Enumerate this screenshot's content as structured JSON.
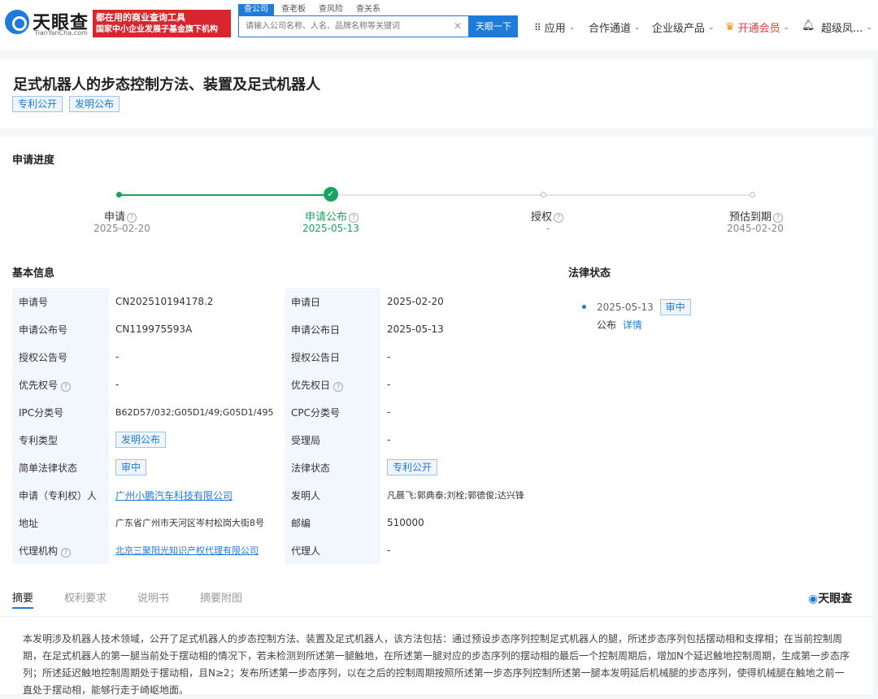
{
  "header": {
    "logo_text": "天眼查",
    "logo_sub": "TianYanCha.com",
    "banner_line1": "都在用的商业查询工具",
    "banner_line2": "国家中小企业发展子基金旗下机构",
    "search_tabs": [
      "查公司",
      "查老板",
      "查风险",
      "查关系"
    ],
    "search_placeholder": "请输入公司名称、人名、品牌名称等关键词",
    "search_button": "天眼一下",
    "nav_apps": "应用",
    "nav_cooperation": "合作通道",
    "nav_products": "企业级产品",
    "nav_vip": "开通会员",
    "nav_user": "超级凤..."
  },
  "title": {
    "text": "足式机器人的步态控制方法、装置及足式机器人",
    "tags": [
      "专利公开",
      "发明公布"
    ]
  },
  "progress": {
    "title": "申请进度",
    "steps": [
      {
        "label": "申请",
        "date": "2025-02-20"
      },
      {
        "label": "申请公布",
        "date": "2025-05-13"
      },
      {
        "label": "授权",
        "date": "-"
      },
      {
        "label": "预估到期",
        "date": "2045-02-20"
      }
    ],
    "completed_steps": 2
  },
  "basic": {
    "title": "基本信息",
    "rows": [
      {
        "k1": "申请号",
        "v1": "CN202510194178.2",
        "k2": "申请日",
        "v2": "2025-02-20"
      },
      {
        "k1": "申请公布号",
        "v1": "CN119975593A",
        "k2": "申请公布日",
        "v2": "2025-05-13"
      },
      {
        "k1": "授权公告号",
        "v1": "-",
        "k2": "授权公告日",
        "v2": "-"
      },
      {
        "k1": "优先权号",
        "v1": "-",
        "k2": "优先权日",
        "v2": "-"
      },
      {
        "k1": "IPC分类号",
        "v1": "B62D57/032;G05D1/49;G05D1/495",
        "k2": "CPC分类号",
        "v2": "-"
      },
      {
        "k1": "专利类型",
        "v1": "发明公布",
        "k2": "受理局",
        "v2": "-"
      },
      {
        "k1": "简单法律状态",
        "v1": "审中",
        "k2": "法律状态",
        "v2": "专利公开"
      },
      {
        "k1": "申请（专利权）人",
        "v1": "广州小鹏汽车科技有限公司",
        "k2": "发明人",
        "v2": "凡晨飞;郭典泰;刘栓;郭德俊;达兴锋"
      },
      {
        "k1": "地址",
        "v1": "广东省广州市天河区岑村松岗大街8号",
        "k2": "邮编",
        "v2": "510000"
      },
      {
        "k1": "代理机构",
        "v1": "北京三聚阳光知识产权代理有限公司",
        "k2": "代理人",
        "v2": "-"
      }
    ]
  },
  "law": {
    "title": "法律状态",
    "date": "2025-05-13",
    "badge": "审中",
    "event": "公布",
    "detail_link": "详情"
  },
  "tabs": [
    "摘要",
    "权利要求",
    "说明书",
    "摘要附图"
  ],
  "brand_mark": "天眼查",
  "abstract": "本发明涉及机器人技术领域，公开了足式机器人的步态控制方法、装置及足式机器人，该方法包括：通过预设步态序列控制足式机器人的腿，所述步态序列包括摆动相和支撑相；在当前控制周期，在足式机器人的第一腿当前处于摆动相的情况下，若未检测到所述第一腿触地，在所述第一腿对应的步态序列的摆动相的最后一个控制周期后，增加N个延迟触地控制周期，生成第一步态序列；所述延迟触地控制周期处于摆动相，且N≥2；发布所述第一步态序列，以在之后的控制周期按照所述第一步态序列控制所述第一腿本发明延后机械腿的步态序列，使得机械腿在触地之前一直处于摆动相，能够行走于崎岖地面。"
}
